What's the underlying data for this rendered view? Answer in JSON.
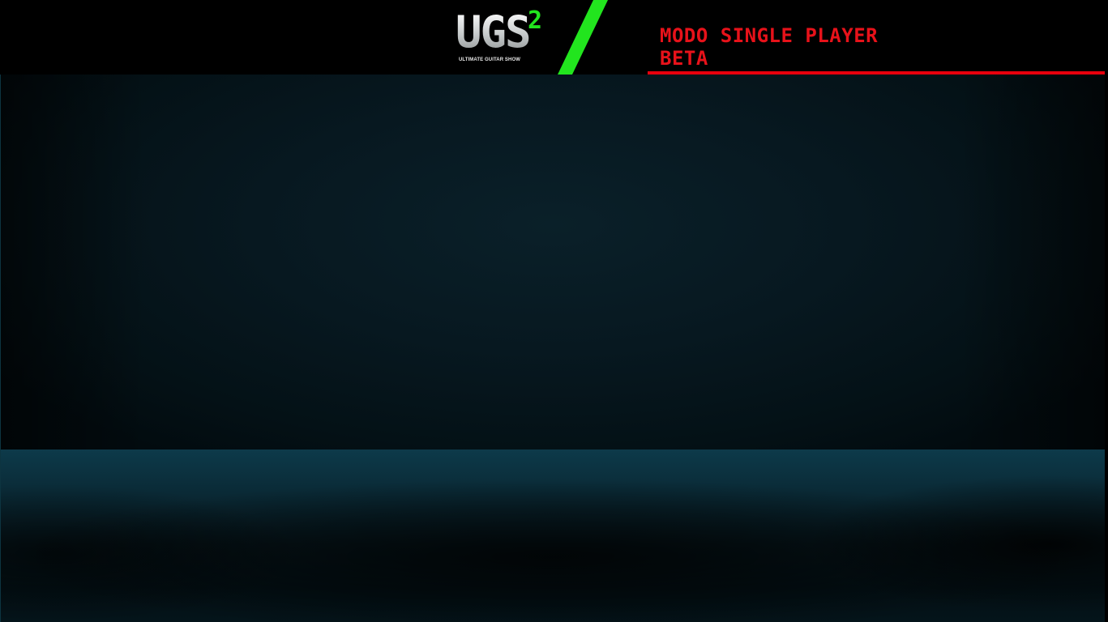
{
  "logo": {
    "mark": "UGS",
    "superscript": "2",
    "tagline": "ULTIMATE GUITAR SHOW",
    "icon": "ugs2-logo"
  },
  "header": {
    "mode_line1": "MODO SINGLE PLAYER",
    "mode_line2": "BETA"
  },
  "colors": {
    "accent_green": "#22e51e",
    "accent_red": "#e8121a",
    "header_bg": "#000000",
    "stage_bg": "#071820"
  }
}
